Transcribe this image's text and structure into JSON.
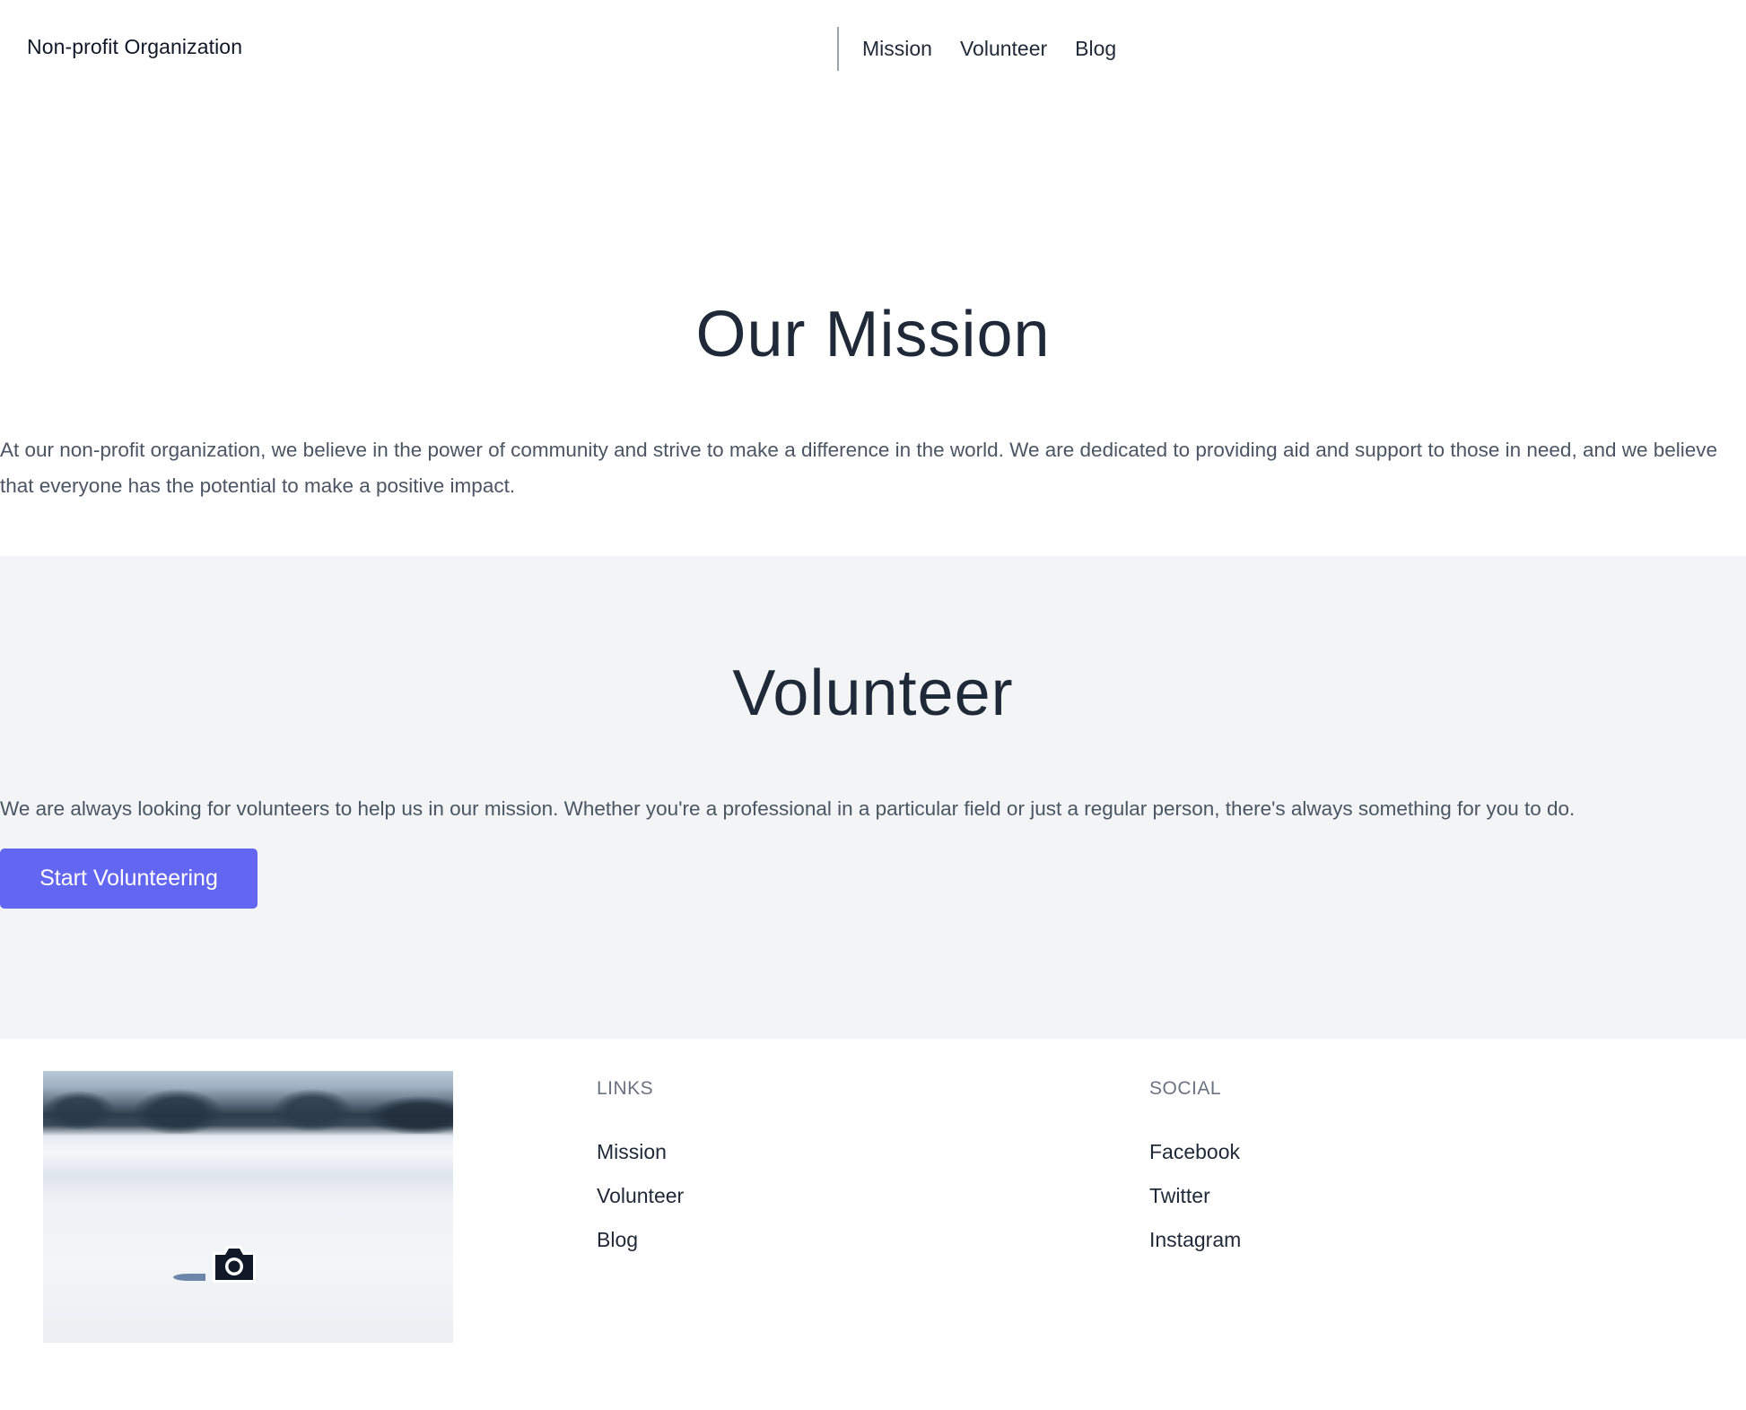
{
  "header": {
    "brand": "Non-profit Organization",
    "nav": [
      {
        "label": "Mission"
      },
      {
        "label": "Volunteer"
      },
      {
        "label": "Blog"
      }
    ]
  },
  "mission": {
    "title": "Our Mission",
    "text": "At our non-profit organization, we believe in the power of community and strive to make a difference in the world. We are dedicated to providing aid and support to those in need, and we believe that everyone has the potential to make a positive impact."
  },
  "volunteer": {
    "title": "Volunteer",
    "text": "We are always looking for volunteers to help us in our mission. Whether you're a professional in a particular field or just a regular person, there's always something for you to do.",
    "cta_label": "Start Volunteering"
  },
  "footer": {
    "image_alt": "Snowy field with camera placeholder",
    "links": {
      "heading": "LINKS",
      "items": [
        {
          "label": "Mission"
        },
        {
          "label": "Volunteer"
        },
        {
          "label": "Blog"
        }
      ]
    },
    "social": {
      "heading": "SOCIAL",
      "items": [
        {
          "label": "Facebook"
        },
        {
          "label": "Twitter"
        },
        {
          "label": "Instagram"
        }
      ]
    }
  },
  "colors": {
    "accent": "#6366f1",
    "section_bg": "#f3f4f6",
    "heading": "#1f2937",
    "body_text": "#4b5563",
    "muted": "#6b7280"
  }
}
